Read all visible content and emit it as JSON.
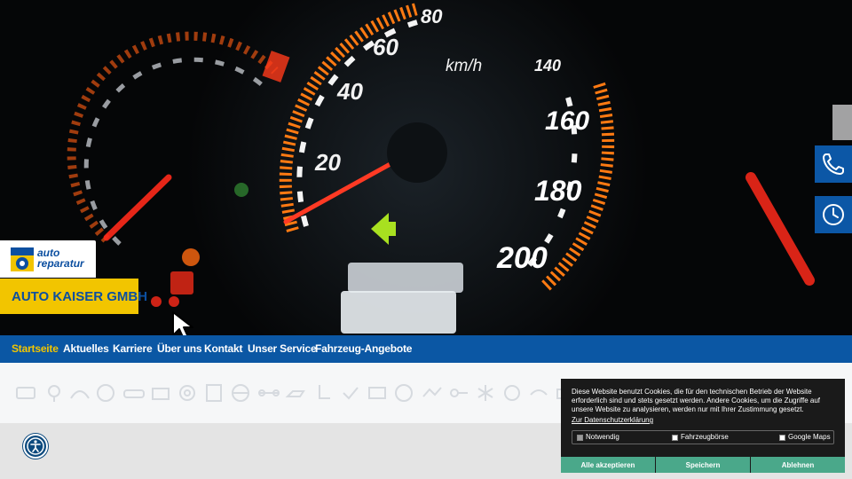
{
  "brand": {
    "logo_line1": "auto",
    "logo_line2": "reparatur",
    "logo_badge": "Meister-betrieb",
    "company_name": "AUTO KAISER GMBH",
    "colors": {
      "blue": "#0b57a4",
      "yellow": "#f2c500",
      "cookie_green": "#4aa88a"
    }
  },
  "nav": {
    "items": [
      {
        "label": "Startseite",
        "active": true
      },
      {
        "label": "Aktuelles",
        "active": false
      },
      {
        "label": "Karriere",
        "active": false
      },
      {
        "label": "Über uns",
        "active": false
      },
      {
        "label": "Kontakt",
        "active": false
      },
      {
        "label": "Unser Service",
        "active": false
      },
      {
        "label": "Fahrzeug-Angebote",
        "active": false
      }
    ]
  },
  "side_buttons": [
    {
      "icon": "phone-icon"
    },
    {
      "icon": "clock-icon"
    }
  ],
  "service_icons": [
    "exhaust-icon",
    "bulb-icon",
    "wiper-icon",
    "tire-icon",
    "car-icon",
    "battery-icon",
    "brake-icon",
    "checklist-icon",
    "steering-icon",
    "axle-icon",
    "oil-icon",
    "seat-icon",
    "check-icon",
    "engine-icon",
    "gauge-icon",
    "inspection-icon",
    "key-icon",
    "snowflake-icon",
    "sun-icon",
    "paint-icon",
    "jack-icon"
  ],
  "accessibility": {
    "icon": "accessibility-icon"
  },
  "cookie": {
    "text": "Diese Website benutzt Cookies, die für den technischen Betrieb der Website erforderlich sind und stets gesetzt werden. Andere Cookies, um die Zugriffe auf unsere Website zu analysieren, werden nur mit Ihrer Zustimmung gesetzt.",
    "link": "Zur Datenschutzerklärung",
    "options": [
      {
        "label": "Notwendig",
        "checked": true
      },
      {
        "label": "Fahrzeugbörse",
        "checked": false
      },
      {
        "label": "Google Maps",
        "checked": false
      }
    ],
    "buttons": {
      "accept_all": "Alle akzeptieren",
      "save": "Speichern",
      "decline": "Ablehnen"
    }
  },
  "speedometer": {
    "unit": "km/h",
    "marks": [
      "20",
      "40",
      "60",
      "80",
      "140",
      "160",
      "180",
      "200"
    ]
  }
}
